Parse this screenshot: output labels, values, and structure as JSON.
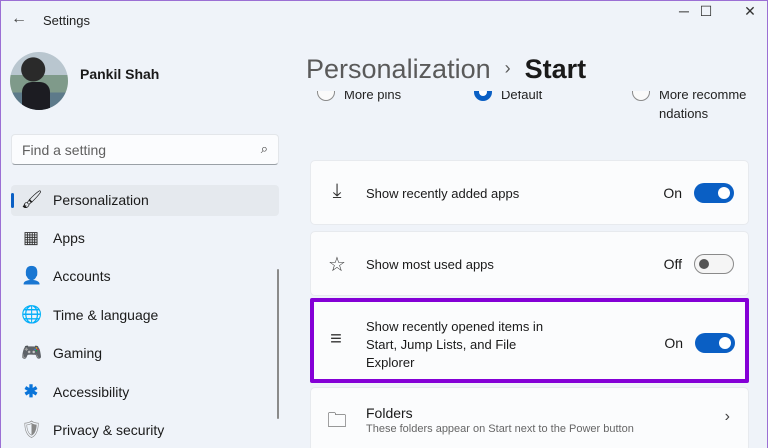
{
  "window": {
    "title": "Settings",
    "back_icon": "arrow-left-icon",
    "minimize": "─",
    "maximize": "☐",
    "close": "✕"
  },
  "user": {
    "name": "Pankil Shah"
  },
  "search": {
    "placeholder": "Find a setting",
    "icon": "⌕"
  },
  "sidebar": {
    "items": [
      {
        "label": "Personalization",
        "icon": "🖌",
        "selected": true
      },
      {
        "label": "Apps",
        "icon": "▦"
      },
      {
        "label": "Accounts",
        "icon": "👤"
      },
      {
        "label": "Time & language",
        "icon": "🌐"
      },
      {
        "label": "Gaming",
        "icon": "🎮"
      },
      {
        "label": "Accessibility",
        "icon": "✱"
      },
      {
        "label": "Privacy & security",
        "icon": "🛡"
      }
    ]
  },
  "breadcrumb": {
    "parent": "Personalization",
    "separator": "›",
    "current": "Start"
  },
  "layout_options": [
    {
      "label": "More pins",
      "selected": false
    },
    {
      "label": "Default",
      "selected": true
    },
    {
      "label": "More recommendations",
      "selected": false
    }
  ],
  "settings": [
    {
      "label": "Show recently added apps",
      "state": "On",
      "on": true,
      "icon": "⤓"
    },
    {
      "label": "Show most used apps",
      "state": "Off",
      "on": false,
      "icon": "☆"
    },
    {
      "label": "Show recently opened items in Start, Jump Lists, and File Explorer",
      "state": "On",
      "on": true,
      "icon": "≡",
      "highlighted": true
    },
    {
      "label": "Folders",
      "description": "These folders appear on Start next to the Power button",
      "icon": "🗀",
      "chevron": "›"
    }
  ],
  "colors": {
    "accent": "#0a5fc4",
    "highlight": "#8400d6"
  }
}
